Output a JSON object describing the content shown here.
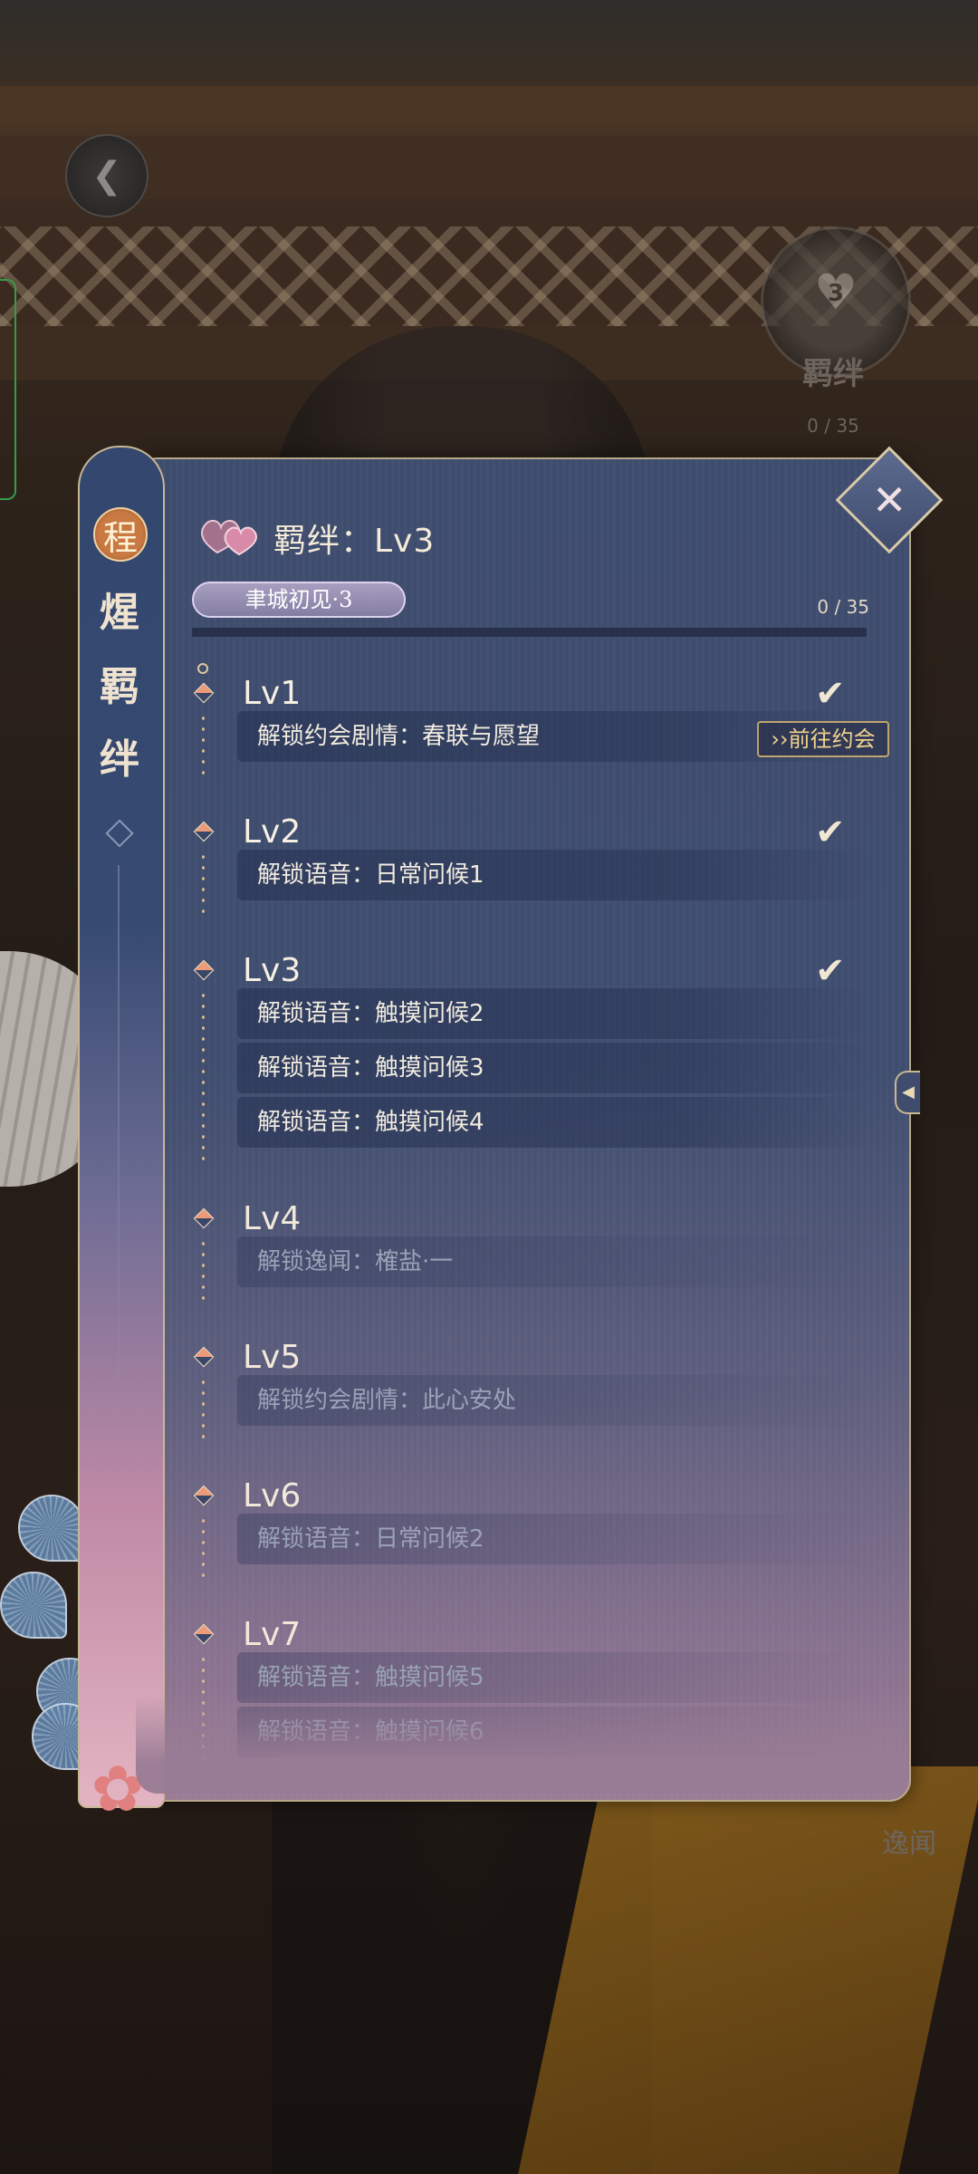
{
  "background": {
    "bond_label": "羁绊",
    "bond_level_number": "3",
    "bond_progress": "0 / 35",
    "anecdote_label": "逸闻"
  },
  "side_strip": {
    "seal_char": "程",
    "chars": [
      "煋",
      "羁",
      "绊"
    ]
  },
  "header": {
    "title": "羁绊：Lv3",
    "stage_badge": "聿城初见·3",
    "progress_text": "0 / 35",
    "progress_fraction": 0
  },
  "goto_date_label": "››前往约会",
  "levels": [
    {
      "label": "Lv1",
      "completed": true,
      "rewards": [
        "解锁约会剧情：春联与愿望"
      ]
    },
    {
      "label": "Lv2",
      "completed": true,
      "rewards": [
        "解锁语音：日常问候1"
      ]
    },
    {
      "label": "Lv3",
      "completed": true,
      "rewards": [
        "解锁语音：触摸问候2",
        "解锁语音：触摸问候3",
        "解锁语音：触摸问候4"
      ]
    },
    {
      "label": "Lv4",
      "completed": false,
      "rewards": [
        "解锁逸闻：榷盐·一"
      ]
    },
    {
      "label": "Lv5",
      "completed": false,
      "rewards": [
        "解锁约会剧情：此心安处"
      ]
    },
    {
      "label": "Lv6",
      "completed": false,
      "rewards": [
        "解锁语音：日常问候2"
      ]
    },
    {
      "label": "Lv7",
      "completed": false,
      "rewards": [
        "解锁语音：触摸问候5",
        "解锁语音：触摸问候6"
      ]
    }
  ],
  "colors": {
    "panel_top": "#3e4c6e",
    "panel_bottom": "#9a7c95",
    "accent_gold": "#c8a36a",
    "check": "#f0e6d2",
    "reward_text": "#f2ece0",
    "locked_text": "#9aa2b6"
  }
}
